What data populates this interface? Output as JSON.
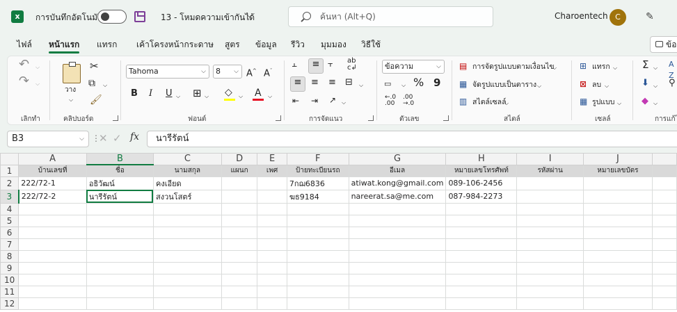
{
  "titlebar": {
    "app_icon": "excel-logo-icon",
    "app_icon_text": "x",
    "autosave_label": "การบันทึกอัตโนมัติ",
    "autosave_state": "off",
    "doc_title": "13  -  โหมดความเข้ากันได้",
    "search_placeholder": "ค้นหา (Alt+Q)",
    "user_name": "Charoentech",
    "avatar_initial": "C"
  },
  "tabs": [
    "ไฟล์",
    "หน้าแรก",
    "แทรก",
    "เค้าโครงหน้ากระดาษ",
    "สูตร",
    "ข้อมูล",
    "รีวิว",
    "มุมมอง",
    "วิธีใช้"
  ],
  "active_tab": "หน้าแรก",
  "comment_button": "ข้อ",
  "ribbon": {
    "clipboard": {
      "paste": "วาง",
      "label": "คลิปบอร์ด"
    },
    "undo_label": "เลิกทำ",
    "font": {
      "name": "Tahoma",
      "size": "8",
      "bold": "B",
      "italic": "I",
      "underline": "U",
      "grow": "A^",
      "shrink": "A˅",
      "fill_letter": "A",
      "label": "ฟอนต์"
    },
    "alignment": {
      "label": "การจัดแนว"
    },
    "number": {
      "format": "ข้อความ",
      "label": "ตัวเลข",
      "percent": "%",
      "comma": "9"
    },
    "styles": {
      "conditional": "การจัดรูปแบบตามเงื่อนไข",
      "as_table": "จัดรูปแบบเป็นตาราง",
      "cell_styles": "สไตล์เซลล์",
      "label": "สไตล์"
    },
    "cells": {
      "insert": "แทรก",
      "delete": "ลบ",
      "format": "รูปแบบ",
      "label": "เซลล์"
    },
    "editing": {
      "label": "การแก้ไ"
    }
  },
  "formula_bar": {
    "name_box": "B3",
    "fx": "fx",
    "content": "นารีรัตน์"
  },
  "sheet": {
    "columns": [
      "A",
      "B",
      "C",
      "D",
      "E",
      "F",
      "G",
      "H",
      "I",
      "J"
    ],
    "selected_column": "B",
    "selected_row": 3,
    "rows": [
      [
        "บ้านเลขที่",
        "ชื่อ",
        "นามสกุล",
        "แผนก",
        "เพศ",
        "ป้ายทะเบียนรถ",
        "อีเมล",
        "หมายเลขโทรศัพท์",
        "รหัสผ่าน",
        "หมายเลขบัตร"
      ],
      [
        "222/72-1",
        "อธิวัฒน์",
        "คงเอียด",
        "",
        "",
        "7กฌ6836",
        "atiwat.kong@gmail.com",
        "089-106-2456",
        "",
        ""
      ],
      [
        "222/72-2",
        "นารีรัตน์",
        "สงวนโสตร์",
        "",
        "",
        "ฆธ9184",
        "nareerat.sa@me.com",
        "087-984-2273",
        "",
        ""
      ],
      [
        "",
        "",
        "",
        "",
        "",
        "",
        "",
        "",
        "",
        ""
      ],
      [
        "",
        "",
        "",
        "",
        "",
        "",
        "",
        "",
        "",
        ""
      ],
      [
        "",
        "",
        "",
        "",
        "",
        "",
        "",
        "",
        "",
        ""
      ],
      [
        "",
        "",
        "",
        "",
        "",
        "",
        "",
        "",
        "",
        ""
      ],
      [
        "",
        "",
        "",
        "",
        "",
        "",
        "",
        "",
        "",
        ""
      ],
      [
        "",
        "",
        "",
        "",
        "",
        "",
        "",
        "",
        "",
        ""
      ],
      [
        "",
        "",
        "",
        "",
        "",
        "",
        "",
        "",
        "",
        ""
      ],
      [
        "",
        "",
        "",
        "",
        "",
        "",
        "",
        "",
        "",
        ""
      ],
      [
        "",
        "",
        "",
        "",
        "",
        "",
        "",
        "",
        "",
        ""
      ]
    ]
  },
  "colors": {
    "accent": "#107c41",
    "avatar": "#a0730b",
    "save_icon": "#7d3f98"
  }
}
